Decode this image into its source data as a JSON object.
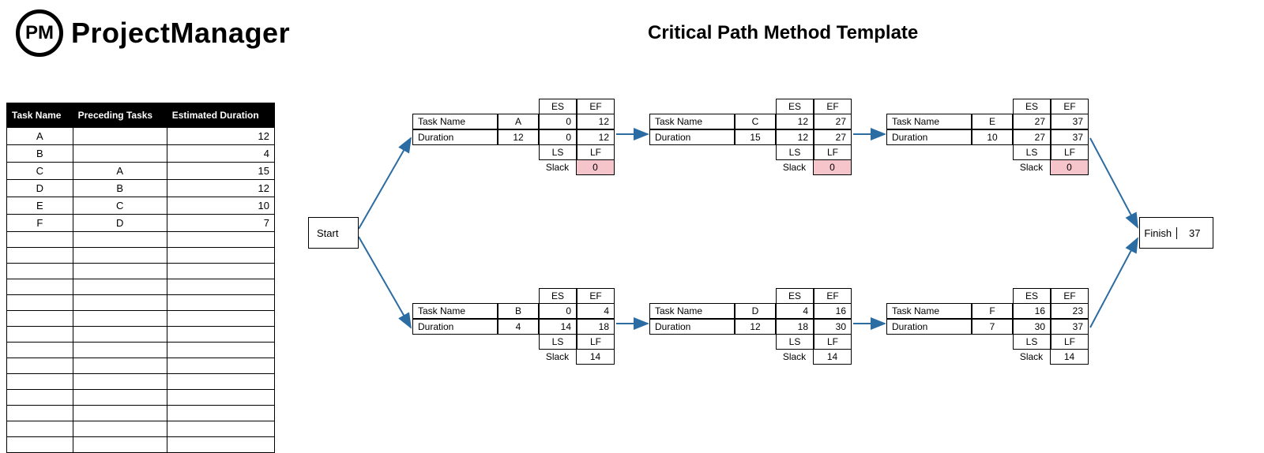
{
  "brand": "ProjectManager",
  "logo_text": "PM",
  "page_title": "Critical Path Method Template",
  "task_list": {
    "headers": [
      "Task Name",
      "Preceding Tasks",
      "Estimated Duration"
    ],
    "rows": [
      {
        "name": "A",
        "prec": "",
        "dur": "12"
      },
      {
        "name": "B",
        "prec": "",
        "dur": "4"
      },
      {
        "name": "C",
        "prec": "A",
        "dur": "15"
      },
      {
        "name": "D",
        "prec": "B",
        "dur": "12"
      },
      {
        "name": "E",
        "prec": "C",
        "dur": "10"
      },
      {
        "name": "F",
        "prec": "D",
        "dur": "7"
      }
    ],
    "empty_rows": 14
  },
  "labels": {
    "start": "Start",
    "finish": "Finish",
    "task_name": "Task Name",
    "duration": "Duration",
    "es": "ES",
    "ef": "EF",
    "ls": "LS",
    "lf": "LF",
    "slack": "Slack"
  },
  "finish_value": "37",
  "nodes": {
    "A": {
      "task": "A",
      "dur": "12",
      "es": "0",
      "ef": "12",
      "ls": "0",
      "lf": "12",
      "slack": "0",
      "crit": true
    },
    "C": {
      "task": "C",
      "dur": "15",
      "es": "12",
      "ef": "27",
      "ls": "12",
      "lf": "27",
      "slack": "0",
      "crit": true
    },
    "E": {
      "task": "E",
      "dur": "10",
      "es": "27",
      "ef": "37",
      "ls": "27",
      "lf": "37",
      "slack": "0",
      "crit": true
    },
    "B": {
      "task": "B",
      "dur": "4",
      "es": "0",
      "ef": "4",
      "ls": "14",
      "lf": "18",
      "slack": "14",
      "crit": false
    },
    "D": {
      "task": "D",
      "dur": "12",
      "es": "4",
      "ef": "16",
      "ls": "18",
      "lf": "30",
      "slack": "14",
      "crit": false
    },
    "F": {
      "task": "F",
      "dur": "7",
      "es": "16",
      "ef": "23",
      "ls": "30",
      "lf": "37",
      "slack": "14",
      "crit": false
    }
  },
  "colors": {
    "arrow": "#2b6ca3",
    "critical_bg": "#f6c4cb"
  }
}
